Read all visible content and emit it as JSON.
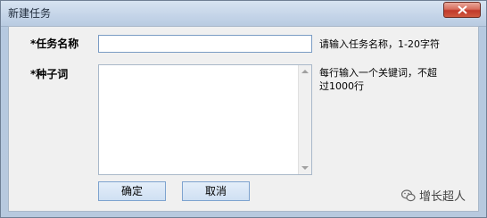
{
  "window": {
    "title": "新建任务"
  },
  "form": {
    "task_name_label": "*任务名称",
    "task_name_value": "",
    "task_name_hint": "请输入任务名称，1-20字符",
    "seed_words_label": "*种子词",
    "seed_words_value": "",
    "seed_words_hint_line1": "每行输入一个关键词，不超",
    "seed_words_hint_line2": "过1000行"
  },
  "buttons": {
    "confirm": "确定",
    "cancel": "取消"
  },
  "watermark": {
    "text": "增长超人"
  },
  "colors": {
    "close_button": "#c0392b",
    "button_border": "#7ea3cf"
  }
}
